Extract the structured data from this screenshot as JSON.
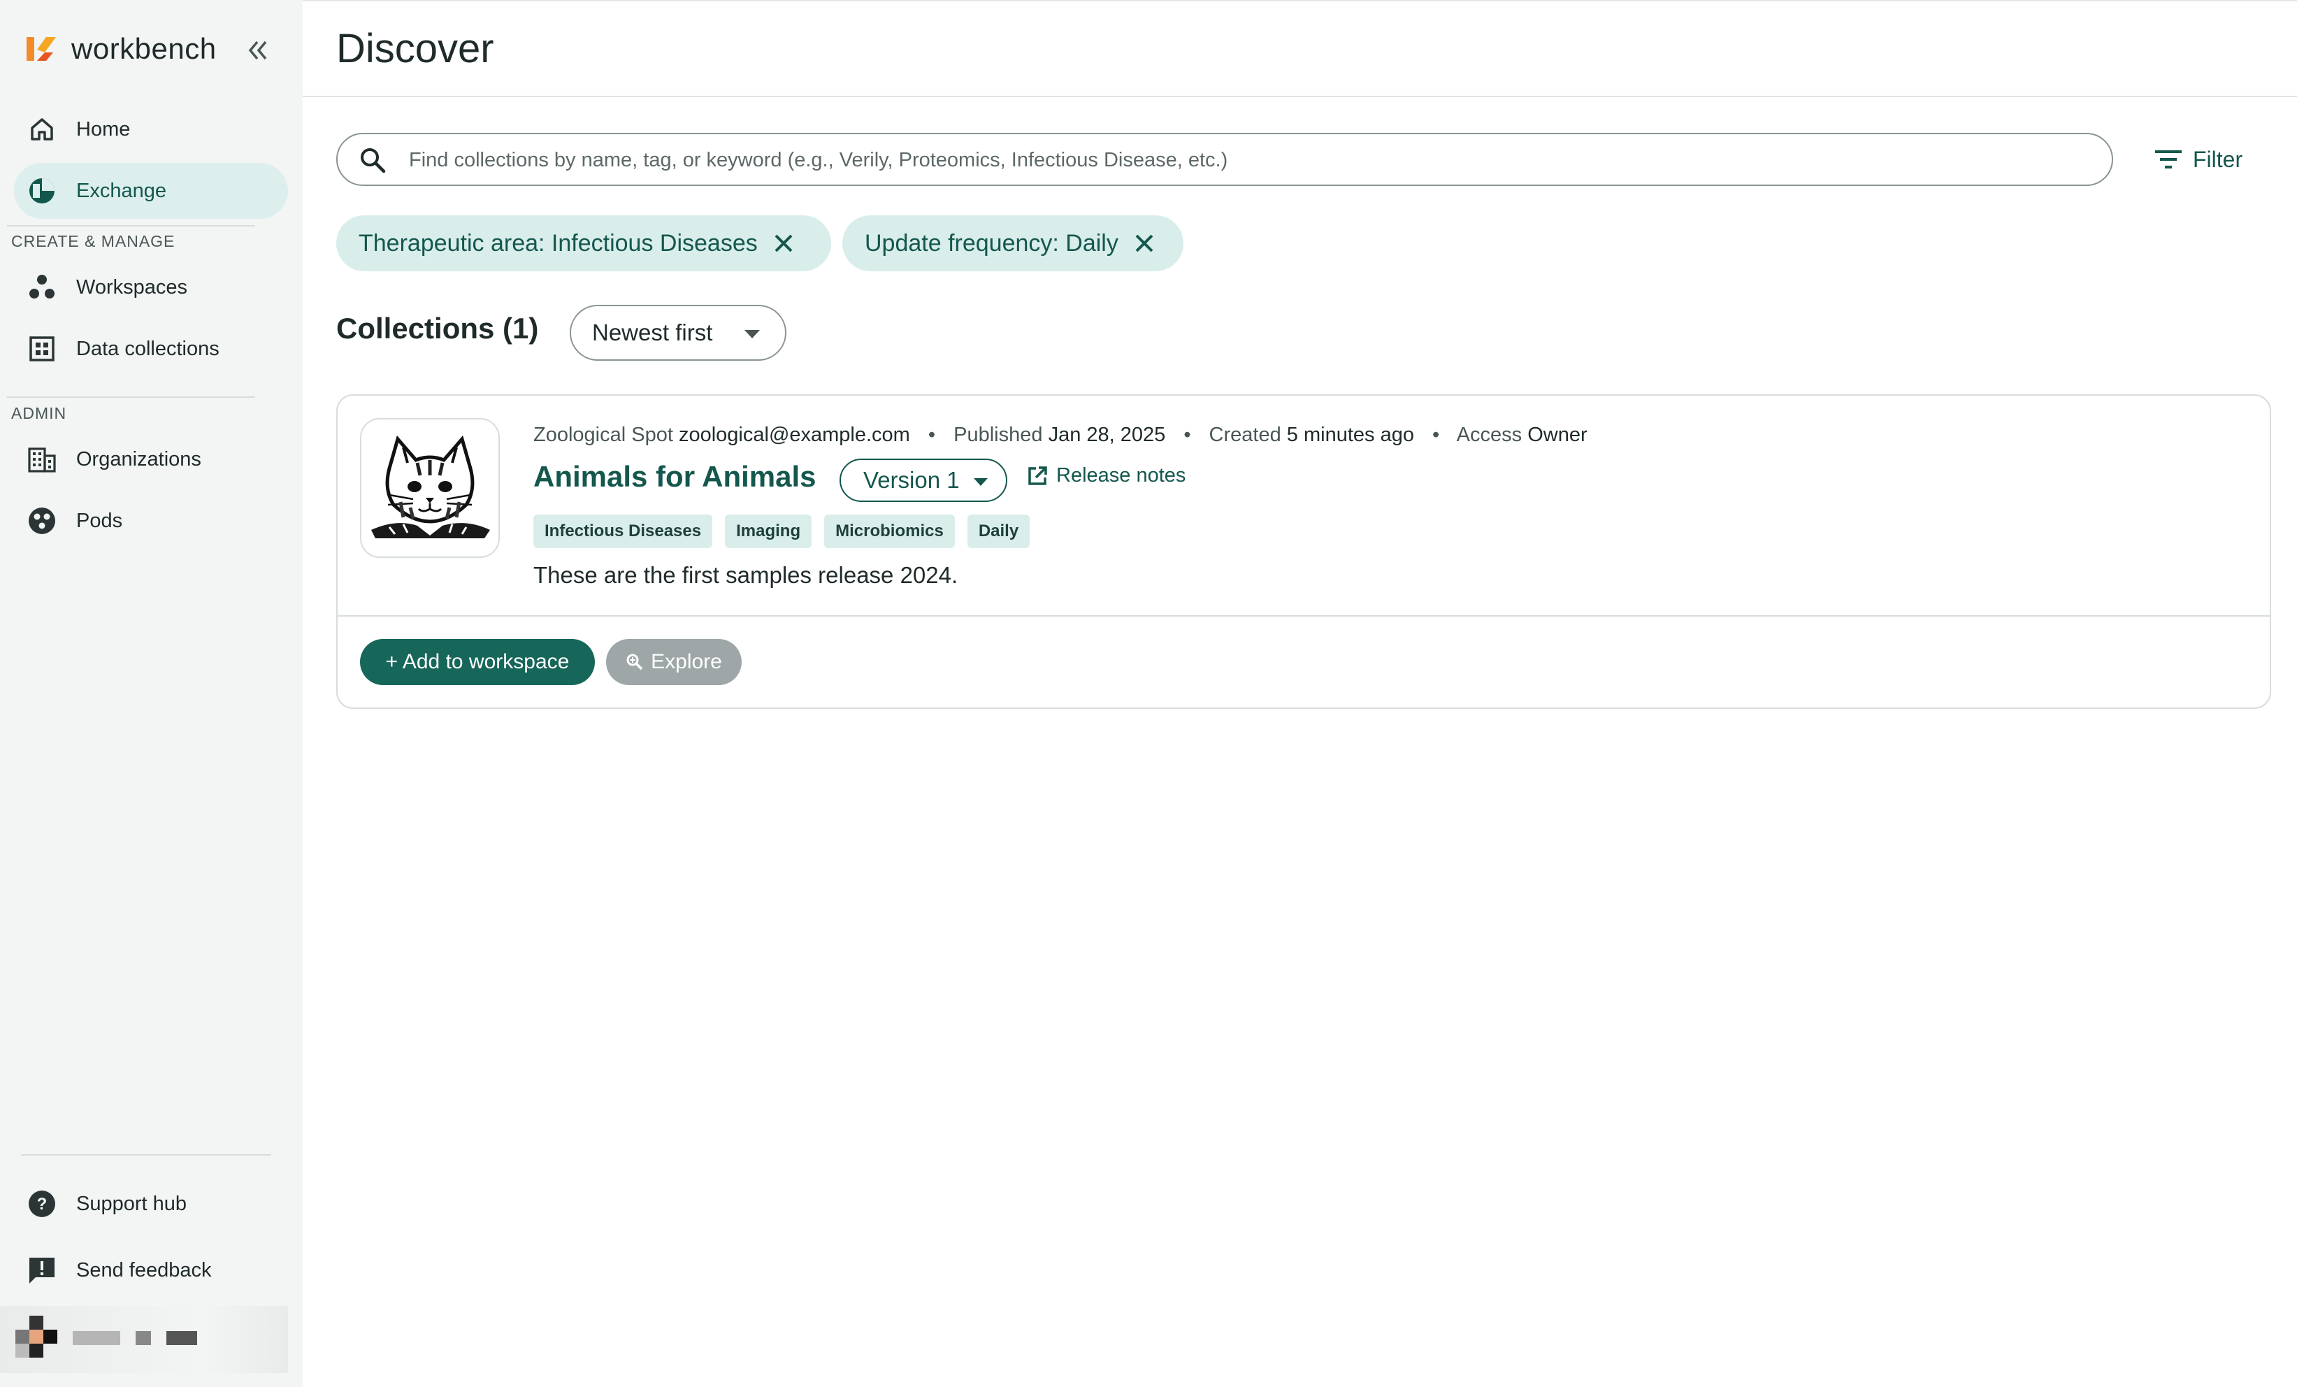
{
  "brand": {
    "name": "workbench"
  },
  "sidebar": {
    "items_top": [
      {
        "label": "Home",
        "icon": "home-icon"
      },
      {
        "label": "Exchange",
        "icon": "exchange-icon",
        "active": true
      }
    ],
    "section_create": "CREATE & MANAGE",
    "items_create": [
      {
        "label": "Workspaces",
        "icon": "workspaces-icon"
      },
      {
        "label": "Data collections",
        "icon": "data-collections-icon"
      }
    ],
    "section_admin": "ADMIN",
    "items_admin": [
      {
        "label": "Organizations",
        "icon": "organizations-icon"
      },
      {
        "label": "Pods",
        "icon": "pods-icon"
      }
    ],
    "items_bottom": [
      {
        "label": "Support hub",
        "icon": "help-icon"
      },
      {
        "label": "Send feedback",
        "icon": "feedback-icon"
      }
    ]
  },
  "header": {
    "title": "Discover"
  },
  "search": {
    "placeholder": "Find collections by name, tag, or keyword (e.g., Verily, Proteomics, Infectious Disease, etc.)",
    "value": ""
  },
  "filter_label": "Filter",
  "active_filters": [
    {
      "label": "Therapeutic area: Infectious Diseases"
    },
    {
      "label": "Update frequency: Daily"
    }
  ],
  "collections": {
    "heading": "Collections (1)",
    "sort": "Newest first",
    "items": [
      {
        "org": "Zoological Spot",
        "email": "zoological@example.com",
        "published_label": "Published",
        "published": "Jan 28, 2025",
        "created_label": "Created",
        "created": "5 minutes ago",
        "access_label": "Access",
        "access": "Owner",
        "title": "Animals for Animals",
        "version": "Version 1",
        "release_notes": "Release notes",
        "tags": [
          "Infectious Diseases",
          "Imaging",
          "Microbiomics",
          "Daily"
        ],
        "description": "These are the first samples release 2024.",
        "add_button": "+ Add to workspace",
        "explore_button": "Explore"
      }
    ]
  },
  "colors": {
    "accent": "#14574d",
    "chip_bg": "#d9eeeb",
    "sidebar_bg": "#f3f4f4",
    "primary_button": "#17665a",
    "disabled_button": "#9ea6a8"
  }
}
